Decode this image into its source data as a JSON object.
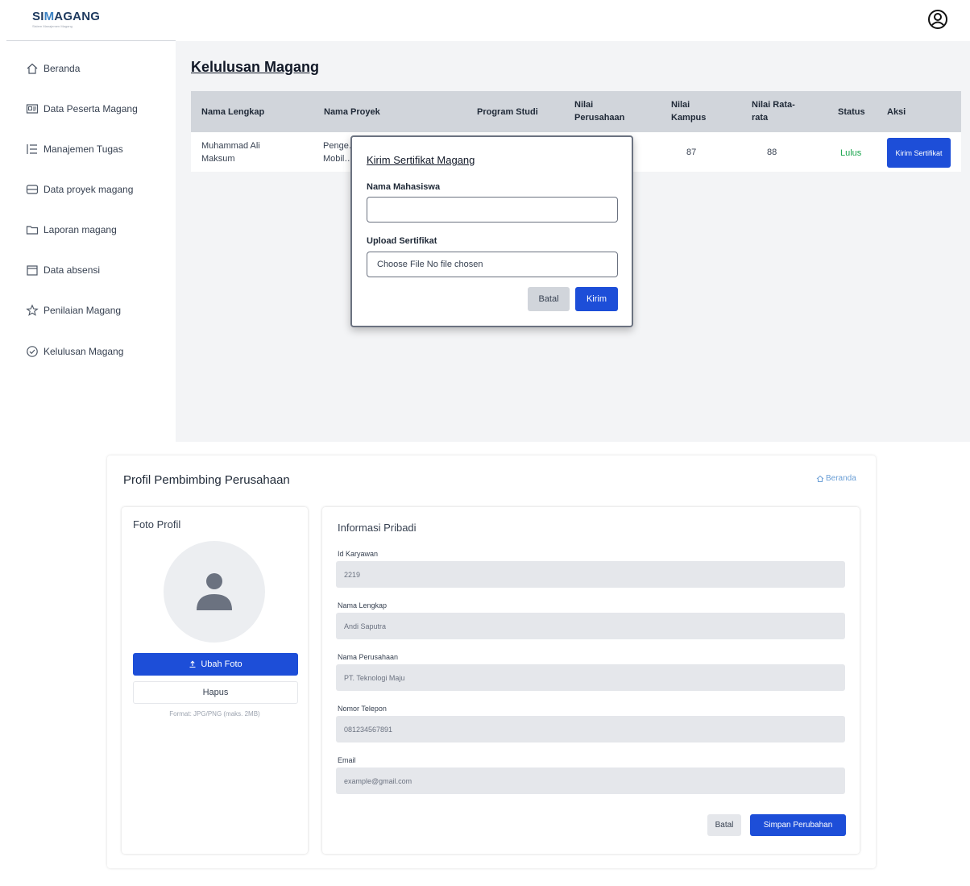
{
  "app": {
    "logo_prefix": "SI",
    "logo_highlight": "M",
    "logo_suffix": "AGANG",
    "logo_subtitle": "Sistem Manajemen Magang"
  },
  "sidebar": {
    "items": [
      {
        "label": "Beranda",
        "icon": "home-icon"
      },
      {
        "label": "Data Peserta Magang",
        "icon": "id-card-icon"
      },
      {
        "label": "Manajemen Tugas",
        "icon": "list-icon"
      },
      {
        "label": "Data proyek magang",
        "icon": "database-icon"
      },
      {
        "label": "Laporan magang",
        "icon": "folder-icon"
      },
      {
        "label": "Data absensi",
        "icon": "calendar-icon"
      },
      {
        "label": "Penilaian Magang",
        "icon": "star-icon"
      },
      {
        "label": "Kelulusan Magang",
        "icon": "check-circle-icon"
      }
    ]
  },
  "kelulusan": {
    "title": "Kelulusan Magang",
    "columns": [
      "Nama Lengkap",
      "Nama Proyek",
      "Program Studi",
      "Nilai Perusahaan",
      "Nilai Kampus",
      "Nilai Rata-rata",
      "Status",
      "Aksi"
    ],
    "rows": [
      {
        "nama": "Muhammad Ali Maksum",
        "proyek": "Penge… Mobil…",
        "prodi": "",
        "nilai_perusahaan": "",
        "nilai_kampus": "87",
        "nilai_rata": "88",
        "status": "Lulus",
        "aksi_label": "Kirim Sertifikat"
      }
    ]
  },
  "modal": {
    "title": "Kirim Sertifikat Magang",
    "nama_label": "Nama Mahasiswa",
    "nama_value": "",
    "upload_label": "Upload Sertifikat",
    "file_text": "Choose File No file chosen",
    "batal": "Batal",
    "kirim": "Kirim"
  },
  "profile": {
    "title": "Profil Pembimbing Perusahaan",
    "beranda_link": "Beranda",
    "photo_card_title": "Foto Profil",
    "ubah_foto": "Ubah Foto",
    "hapus": "Hapus",
    "format_note": "Format: JPG/PNG (maks. 2MB)",
    "info_title": "Informasi Pribadi",
    "fields": [
      {
        "label": "Id Karyawan",
        "value": "2219"
      },
      {
        "label": "Nama Lengkap",
        "value": "Andi Saputra"
      },
      {
        "label": "Nama Perusahaan",
        "value": "PT. Teknologi Maju"
      },
      {
        "label": "Nomor Telepon",
        "value": "081234567891"
      },
      {
        "label": "Email",
        "value": "example@gmail.com"
      }
    ],
    "batal": "Batal",
    "simpan": "Simpan Perubahan"
  },
  "colors": {
    "primary": "#1d4ed8",
    "status_ok": "#16a34a",
    "table_header": "#d1d5db",
    "content_bg": "#f3f4f6"
  }
}
